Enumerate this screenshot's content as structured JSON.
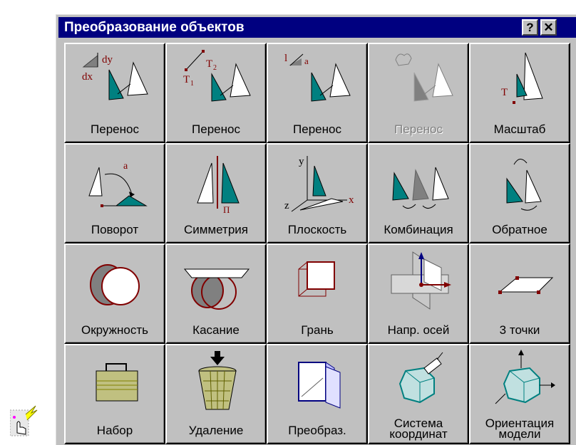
{
  "window": {
    "title": "Преобразование объектов",
    "help_label": "?",
    "close_label": "✕"
  },
  "tools": [
    {
      "label": "Перенос",
      "icon": "move-dxdy-icon",
      "disabled": false
    },
    {
      "label": "Перенос",
      "icon": "move-two-points-icon",
      "disabled": false
    },
    {
      "label": "Перенос",
      "icon": "move-length-angle-icon",
      "disabled": false
    },
    {
      "label": "Перенос",
      "icon": "move-by-hand-icon",
      "disabled": true
    },
    {
      "label": "Масштаб",
      "icon": "scale-icon",
      "disabled": false
    },
    {
      "label": "Поворот",
      "icon": "rotate-icon",
      "disabled": false
    },
    {
      "label": "Симметрия",
      "icon": "symmetry-icon",
      "disabled": false
    },
    {
      "label": "Плоскость",
      "icon": "plane-icon",
      "disabled": false
    },
    {
      "label": "Комбинация",
      "icon": "combination-icon",
      "disabled": false
    },
    {
      "label": "Обратное",
      "icon": "inverse-icon",
      "disabled": false
    },
    {
      "label": "Окружность",
      "icon": "circle-icon",
      "disabled": false
    },
    {
      "label": "Касание",
      "icon": "tangent-icon",
      "disabled": false
    },
    {
      "label": "Грань",
      "icon": "face-icon",
      "disabled": false
    },
    {
      "label": "Напр. осей",
      "icon": "axis-direction-icon",
      "disabled": false
    },
    {
      "label": "3 точки",
      "icon": "three-points-icon",
      "disabled": false
    },
    {
      "label": "Набор",
      "icon": "set-briefcase-icon",
      "disabled": false
    },
    {
      "label": "Удаление",
      "icon": "delete-basket-icon",
      "disabled": false
    },
    {
      "label": "Преобраз.",
      "icon": "transforms-stack-icon",
      "disabled": false
    },
    {
      "label": "Система\nкоординат",
      "icon": "coordinate-system-icon",
      "disabled": false
    },
    {
      "label": "Ориентация\nмодели",
      "icon": "model-orientation-icon",
      "disabled": false
    }
  ],
  "icon_text": {
    "dy": "dy",
    "dx": "dx",
    "t1": "T",
    "t1_sub": "1",
    "t2": "T",
    "t2_sub": "2",
    "l": "l",
    "a": "a",
    "t": "T",
    "pi": "П",
    "y": "y",
    "x": "x",
    "z": "z"
  },
  "colors": {
    "teal": "#008080",
    "red": "#800000",
    "blue": "#000080",
    "olive": "#808000"
  }
}
